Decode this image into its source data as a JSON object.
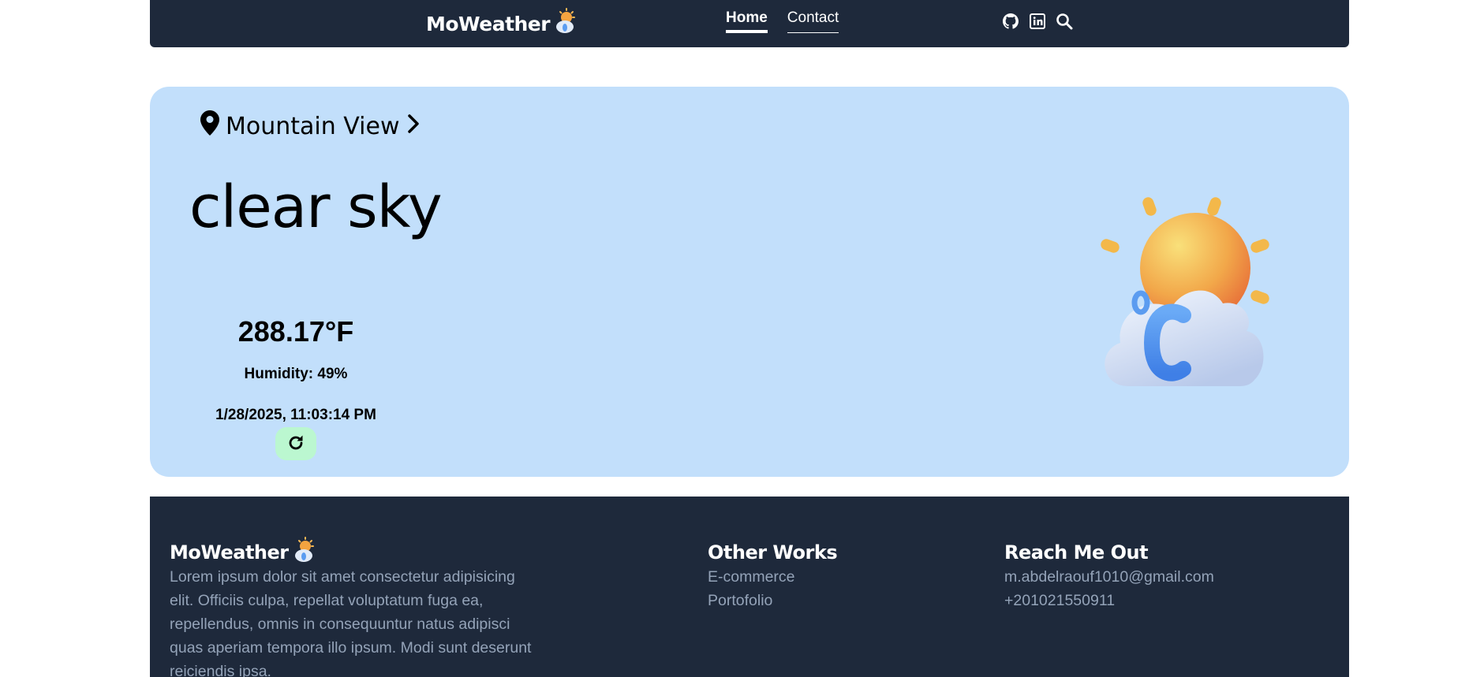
{
  "nav": {
    "brand": "MoWeather",
    "links": [
      {
        "label": "Home",
        "active": true
      },
      {
        "label": "Contact",
        "active": false
      }
    ],
    "icons": [
      "github-icon",
      "linkedin-icon",
      "search-icon"
    ]
  },
  "weather": {
    "location": "Mountain View",
    "condition": "clear sky",
    "temperature": "288.17°F",
    "humidity": "Humidity: 49%",
    "datetime": "1/28/2025, 11:03:14 PM",
    "illustration": "sun-cloud-celsius-icon"
  },
  "footer": {
    "brand": "MoWeather",
    "about": "Lorem ipsum dolor sit amet consectetur adipisicing elit. Officiis culpa, repellat voluptatum fuga ea, repellendus, omnis in consequuntur natus adipisci quas aperiam tempora illo ipsum. Modi sunt deserunt reiciendis ipsa.",
    "other_works": {
      "title": "Other Works",
      "links": [
        "E-commerce",
        "Portofolio"
      ]
    },
    "reach": {
      "title": "Reach Me Out",
      "email": "m.abdelraouf1010@gmail.com",
      "phone": "+201021550911"
    }
  },
  "colors": {
    "nav_bg": "#1e293b",
    "card_bg": "#c2dffb",
    "refresh_bg": "#bbf7d0",
    "footer_text": "#94a3b8"
  }
}
